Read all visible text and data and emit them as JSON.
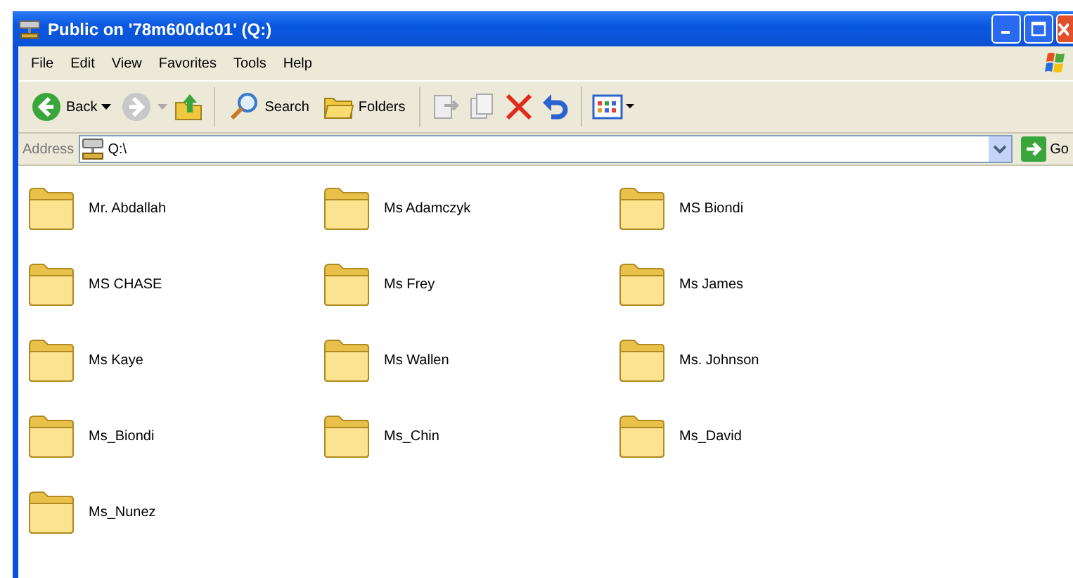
{
  "window": {
    "title": "Public on '78m600dc01' (Q:)"
  },
  "menu": [
    "File",
    "Edit",
    "View",
    "Favorites",
    "Tools",
    "Help"
  ],
  "toolbar": {
    "back": "Back",
    "search": "Search",
    "folders": "Folders"
  },
  "address": {
    "label": "Address",
    "value": "Q:\\",
    "go": "Go"
  },
  "folders": [
    {
      "name": "Mr. Abdallah"
    },
    {
      "name": "Ms Adamczyk"
    },
    {
      "name": "MS Biondi"
    },
    {
      "name": "MS CHASE"
    },
    {
      "name": "Ms Frey"
    },
    {
      "name": "Ms James"
    },
    {
      "name": "Ms Kaye"
    },
    {
      "name": "Ms Wallen"
    },
    {
      "name": "Ms. Johnson"
    },
    {
      "name": "Ms_Biondi"
    },
    {
      "name": "Ms_Chin"
    },
    {
      "name": "Ms_David"
    },
    {
      "name": "Ms_Nunez"
    }
  ]
}
